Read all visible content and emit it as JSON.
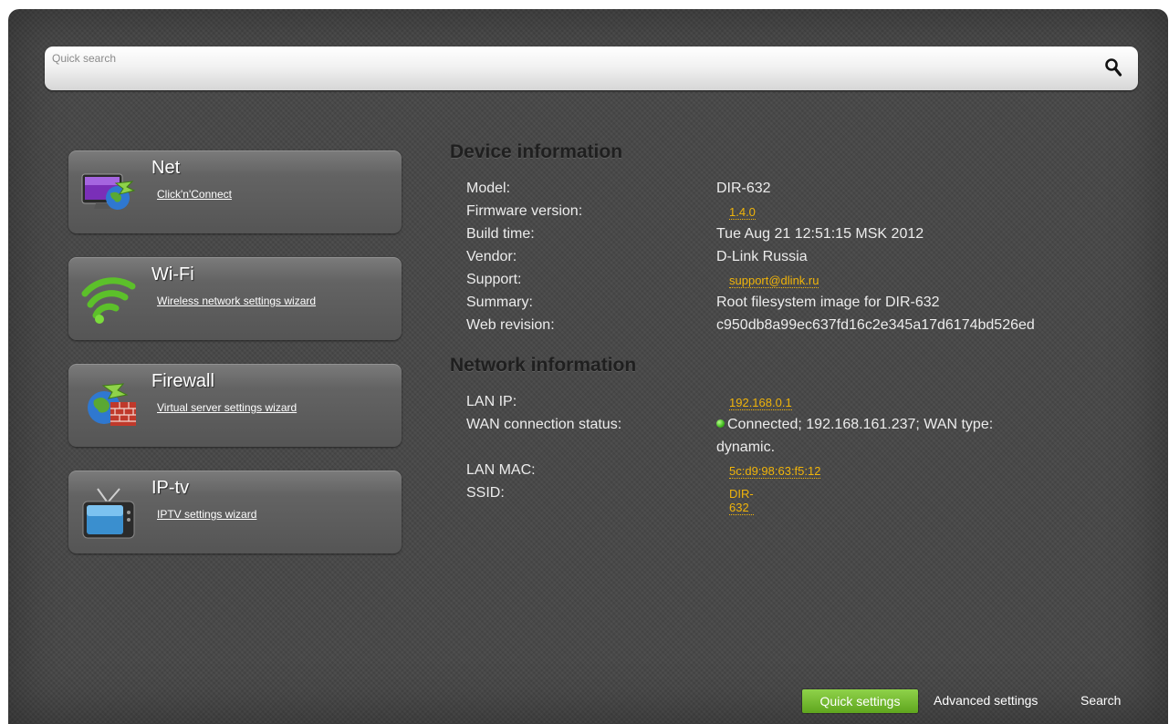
{
  "search": {
    "placeholder": "Quick search",
    "value": ""
  },
  "menu_cards": [
    {
      "title": "Net",
      "link": "Click'n'Connect",
      "icon": "monitor-globe-icon"
    },
    {
      "title": "Wi-Fi",
      "link": "Wireless network settings wizard",
      "icon": "wifi-icon"
    },
    {
      "title": "Firewall",
      "link": "Virtual server settings wizard",
      "icon": "globe-firewall-icon"
    },
    {
      "title": "IP-tv",
      "link": "IPTV settings wizard",
      "icon": "tv-icon"
    }
  ],
  "device_info": {
    "title": "Device information",
    "model_label": "Model:",
    "model": "DIR-632",
    "firmware_label": "Firmware version:",
    "firmware": "1.4.0",
    "build_label": "Build time:",
    "build": "Tue Aug 21 12:51:15 MSK 2012",
    "vendor_label": "Vendor:",
    "vendor": "D-Link Russia",
    "support_label": "Support:",
    "support": "support@dlink.ru",
    "summary_label": "Summary:",
    "summary": "Root filesystem image for DIR-632",
    "webrev_label": "Web revision:",
    "webrev": "c950db8a99ec637fd16c2e345a17d6174bd526ed"
  },
  "network_info": {
    "title": "Network information",
    "lanip_label": "LAN IP:",
    "lanip": "192.168.0.1",
    "wan_label": "WAN connection status:",
    "wan_line1": "Connected; 192.168.161.237; WAN type:",
    "wan_line2": "dynamic.",
    "wan_status_color": "#3fb81c",
    "lanmac_label": "LAN MAC:",
    "lanmac": "5c:d9:98:63:f5:12",
    "ssid_label": "SSID:",
    "ssid": "DIR-632"
  },
  "bottom_nav": {
    "quick": "Quick settings",
    "advanced": "Advanced settings",
    "search": "Search"
  },
  "colors": {
    "accent_link": "#f0b40a",
    "active_nav": "#6db52a",
    "panel_bg": "#474747"
  }
}
